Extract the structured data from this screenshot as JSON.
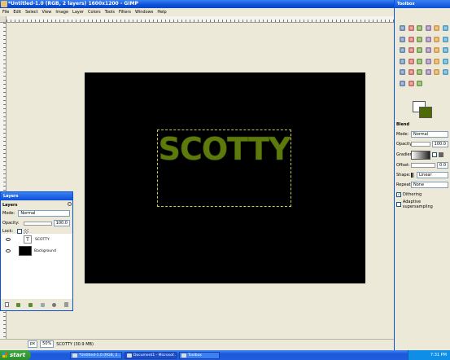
{
  "window": {
    "title": "*Untitled-1.0 (RGB, 2 layers) 1600x1200 - GIMP"
  },
  "menu": [
    "File",
    "Edit",
    "Select",
    "View",
    "Image",
    "Layer",
    "Colors",
    "Tools",
    "Filters",
    "Windows",
    "Help"
  ],
  "canvas": {
    "text": "SCOTTY",
    "text_color": "#5d7a0c",
    "background": "#000000"
  },
  "status": {
    "unit": "px",
    "zoom": "50%",
    "info": "SCOTTY (30.9 MB)"
  },
  "toolbox": {
    "title": "Toolbox",
    "tools": [
      "rect-select",
      "ellipse-select",
      "free-select",
      "fuzzy-select",
      "by-color-select",
      "scissors",
      "foreground-select",
      "paths",
      "color-picker",
      "zoom",
      "measure",
      "move",
      "align",
      "crop",
      "rotate",
      "scale",
      "shear",
      "perspective",
      "flip",
      "text",
      "bucket-fill",
      "blend",
      "pencil",
      "paintbrush",
      "eraser",
      "airbrush",
      "ink",
      "clone",
      "heal",
      "perspective-clone",
      "convolve",
      "smudge",
      "dodge-burn"
    ],
    "foreground": "#ffffff",
    "background": "#4d6a07"
  },
  "blend": {
    "title": "Blend",
    "mode_label": "Mode:",
    "mode": "Normal",
    "opacity_label": "Opacity:",
    "opacity": "100.0",
    "gradient_label": "Gradient:",
    "offset_label": "Offset:",
    "offset": "0.0",
    "shape_label": "Shape:",
    "shape": "Linear",
    "repeat_label": "Repeat:",
    "repeat": "None",
    "dithering": "Dithering",
    "adaptive": "Adaptive supersampling"
  },
  "layers": {
    "title": "Layers",
    "header": "Layers",
    "mode_label": "Mode:",
    "mode": "Normal",
    "opacity_label": "Opacity:",
    "opacity": "100.0",
    "lock_label": "Lock:",
    "items": [
      {
        "name": "SCOTTY"
      },
      {
        "name": "Background"
      }
    ]
  },
  "taskbar": {
    "start": "start",
    "tasks": [
      "*Untitled-1.0 (RGB, 2...",
      "Document1 - Microsof...",
      "Toolbox"
    ],
    "clock": "7:31 PM"
  }
}
